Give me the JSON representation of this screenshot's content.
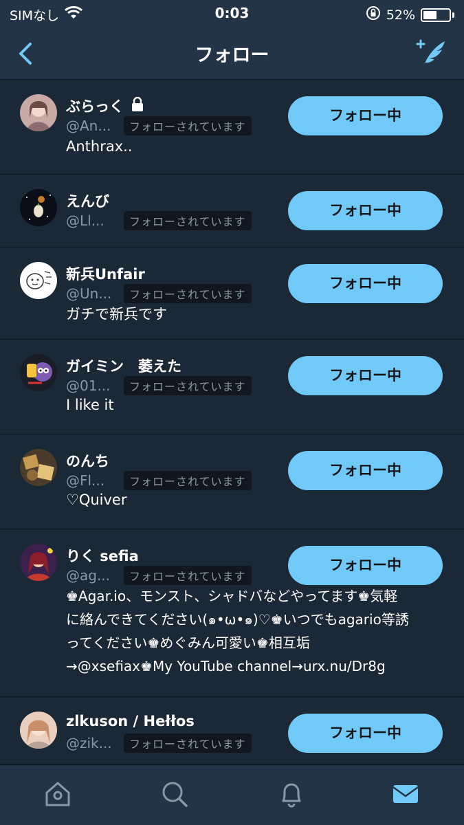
{
  "status_bar": {
    "carrier": "SIMなし",
    "time": "0:03",
    "battery_percent": "52%",
    "battery_level": 0.52
  },
  "nav": {
    "title": "フォロー",
    "back_icon": "chevron-left-icon",
    "compose_icon": "compose-tweet-icon"
  },
  "colors": {
    "background": "#15202b",
    "bar": "#243447",
    "row": "#1b2836",
    "accent": "#71c9f8",
    "muted": "#8899a6"
  },
  "users": [
    {
      "name": "ぶらっく",
      "locked": true,
      "handle": "@An...",
      "follows_you": "フォローされています",
      "bio": [
        "Anthrax.."
      ],
      "button": "フォロー中"
    },
    {
      "name": "えんび",
      "locked": false,
      "handle": "@Ll...",
      "follows_you": "フォローされています",
      "bio": [],
      "button": "フォロー中"
    },
    {
      "name": "新兵Unfair",
      "locked": false,
      "handle": "@Un...",
      "follows_you": "フォローされています",
      "bio": [
        "ガチで新兵です"
      ],
      "button": "フォロー中"
    },
    {
      "name": "ガイミン　萎えた",
      "locked": false,
      "handle": "@01...",
      "follows_you": "フォローされています",
      "bio": [
        "I like it"
      ],
      "button": "フォロー中"
    },
    {
      "name": "のんち",
      "locked": false,
      "handle": "@Fl...",
      "follows_you": "フォローされています",
      "bio": [
        "♡Quiver"
      ],
      "button": "フォロー中"
    },
    {
      "name": "りく sefia",
      "locked": false,
      "handle": "@ag...",
      "follows_you": "フォローされています",
      "bio": [
        "♚Agar.io、モンスト、シャドバなどやってます♚気軽",
        "に絡んできてください(๑•ω•๑)♡♚いつでもagario等誘",
        "ってください♚めぐみん可愛い♚相互垢",
        "→@xsefiax♚My YouTube channel→urx.nu/Dr8g"
      ],
      "button": "フォロー中"
    },
    {
      "name": "zlkuson / Hełłos",
      "locked": false,
      "handle": "@zik...",
      "follows_you": "フォローされています",
      "bio": [],
      "button": "フォロー中"
    }
  ],
  "tab_bar": {
    "tabs": [
      "home-icon",
      "search-icon",
      "notifications-icon",
      "messages-icon"
    ],
    "active": "messages-icon"
  }
}
